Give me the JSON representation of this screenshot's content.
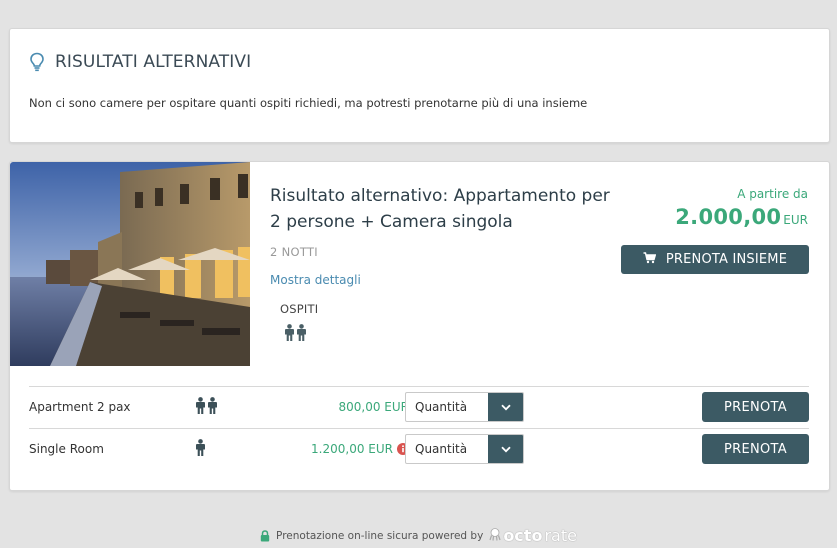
{
  "alert": {
    "icon": "lightbulb-icon",
    "title": "RISULTATI ALTERNATIVI",
    "text": "Non ci sono camere per ospitare quanti ospiti richiedi, ma potresti prenotarne più di una insieme"
  },
  "result": {
    "title": "Risultato alternativo: Appartamento per 2 persone + Camera singola",
    "nights": "2 NOTTI",
    "details_link": "Mostra dettagli",
    "guests_label": "OSPITI",
    "guests_count": 2,
    "from_label": "A partire da",
    "total_amount": "2.000,00",
    "total_currency": "EUR",
    "book_together_label": "PRENOTA INSIEME"
  },
  "rooms": [
    {
      "name": "Apartment 2 pax",
      "guests": 2,
      "price": "800,00 EUR",
      "info": false,
      "qty_placeholder": "Quantità",
      "book_label": "PRENOTA"
    },
    {
      "name": "Single Room",
      "guests": 1,
      "price": "1.200,00 EUR",
      "info": true,
      "qty_placeholder": "Quantità",
      "book_label": "PRENOTA"
    }
  ],
  "footer": {
    "text": "Prenotazione on-line sicura powered by",
    "brand_octo": "octo",
    "brand_rate": "rate"
  },
  "colors": {
    "accent_green": "#3ba87a",
    "button_dark": "#3c5a64",
    "link_blue": "#4a8bb0",
    "info_red": "#d9534f"
  }
}
